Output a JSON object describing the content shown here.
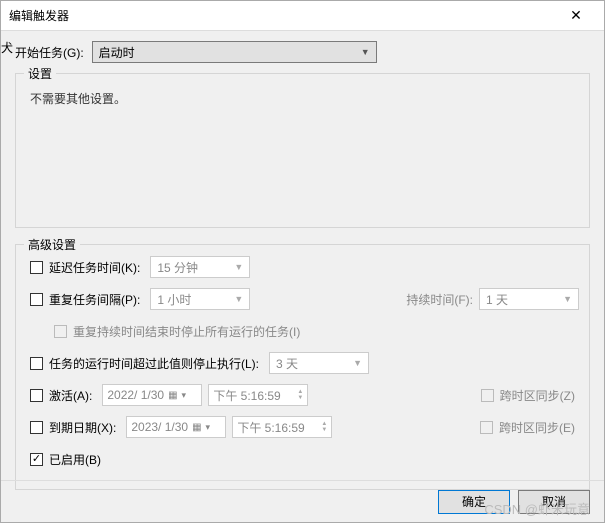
{
  "window": {
    "title": "编辑触发器",
    "left_edge": "犬"
  },
  "trigger": {
    "begin_label": "开始任务(G):",
    "begin_value": "启动时"
  },
  "settings": {
    "group_label": "设置",
    "no_other": "不需要其他设置。"
  },
  "advanced": {
    "group_label": "高级设置",
    "delay_label": "延迟任务时间(K):",
    "delay_value": "15 分钟",
    "repeat_label": "重复任务间隔(P):",
    "repeat_value": "1 小时",
    "duration_label": "持续时间(F):",
    "duration_value": "1 天",
    "stop_repeat_label": "重复持续时间结束时停止所有运行的任务(I)",
    "stop_exceed_label": "任务的运行时间超过此值则停止执行(L):",
    "stop_exceed_value": "3 天",
    "activate_label": "激活(A):",
    "activate_date": "2022/ 1/30",
    "activate_time": "下午  5:16:59",
    "expire_label": "到期日期(X):",
    "expire_date": "2023/ 1/30",
    "expire_time": "下午  5:16:59",
    "tz_sync_z": "跨时区同步(Z)",
    "tz_sync_e": "跨时区同步(E)",
    "enabled_label": "已启用(B)"
  },
  "buttons": {
    "ok": "确定",
    "cancel": "取消"
  },
  "watermark": "CSDN @虾米玩意"
}
